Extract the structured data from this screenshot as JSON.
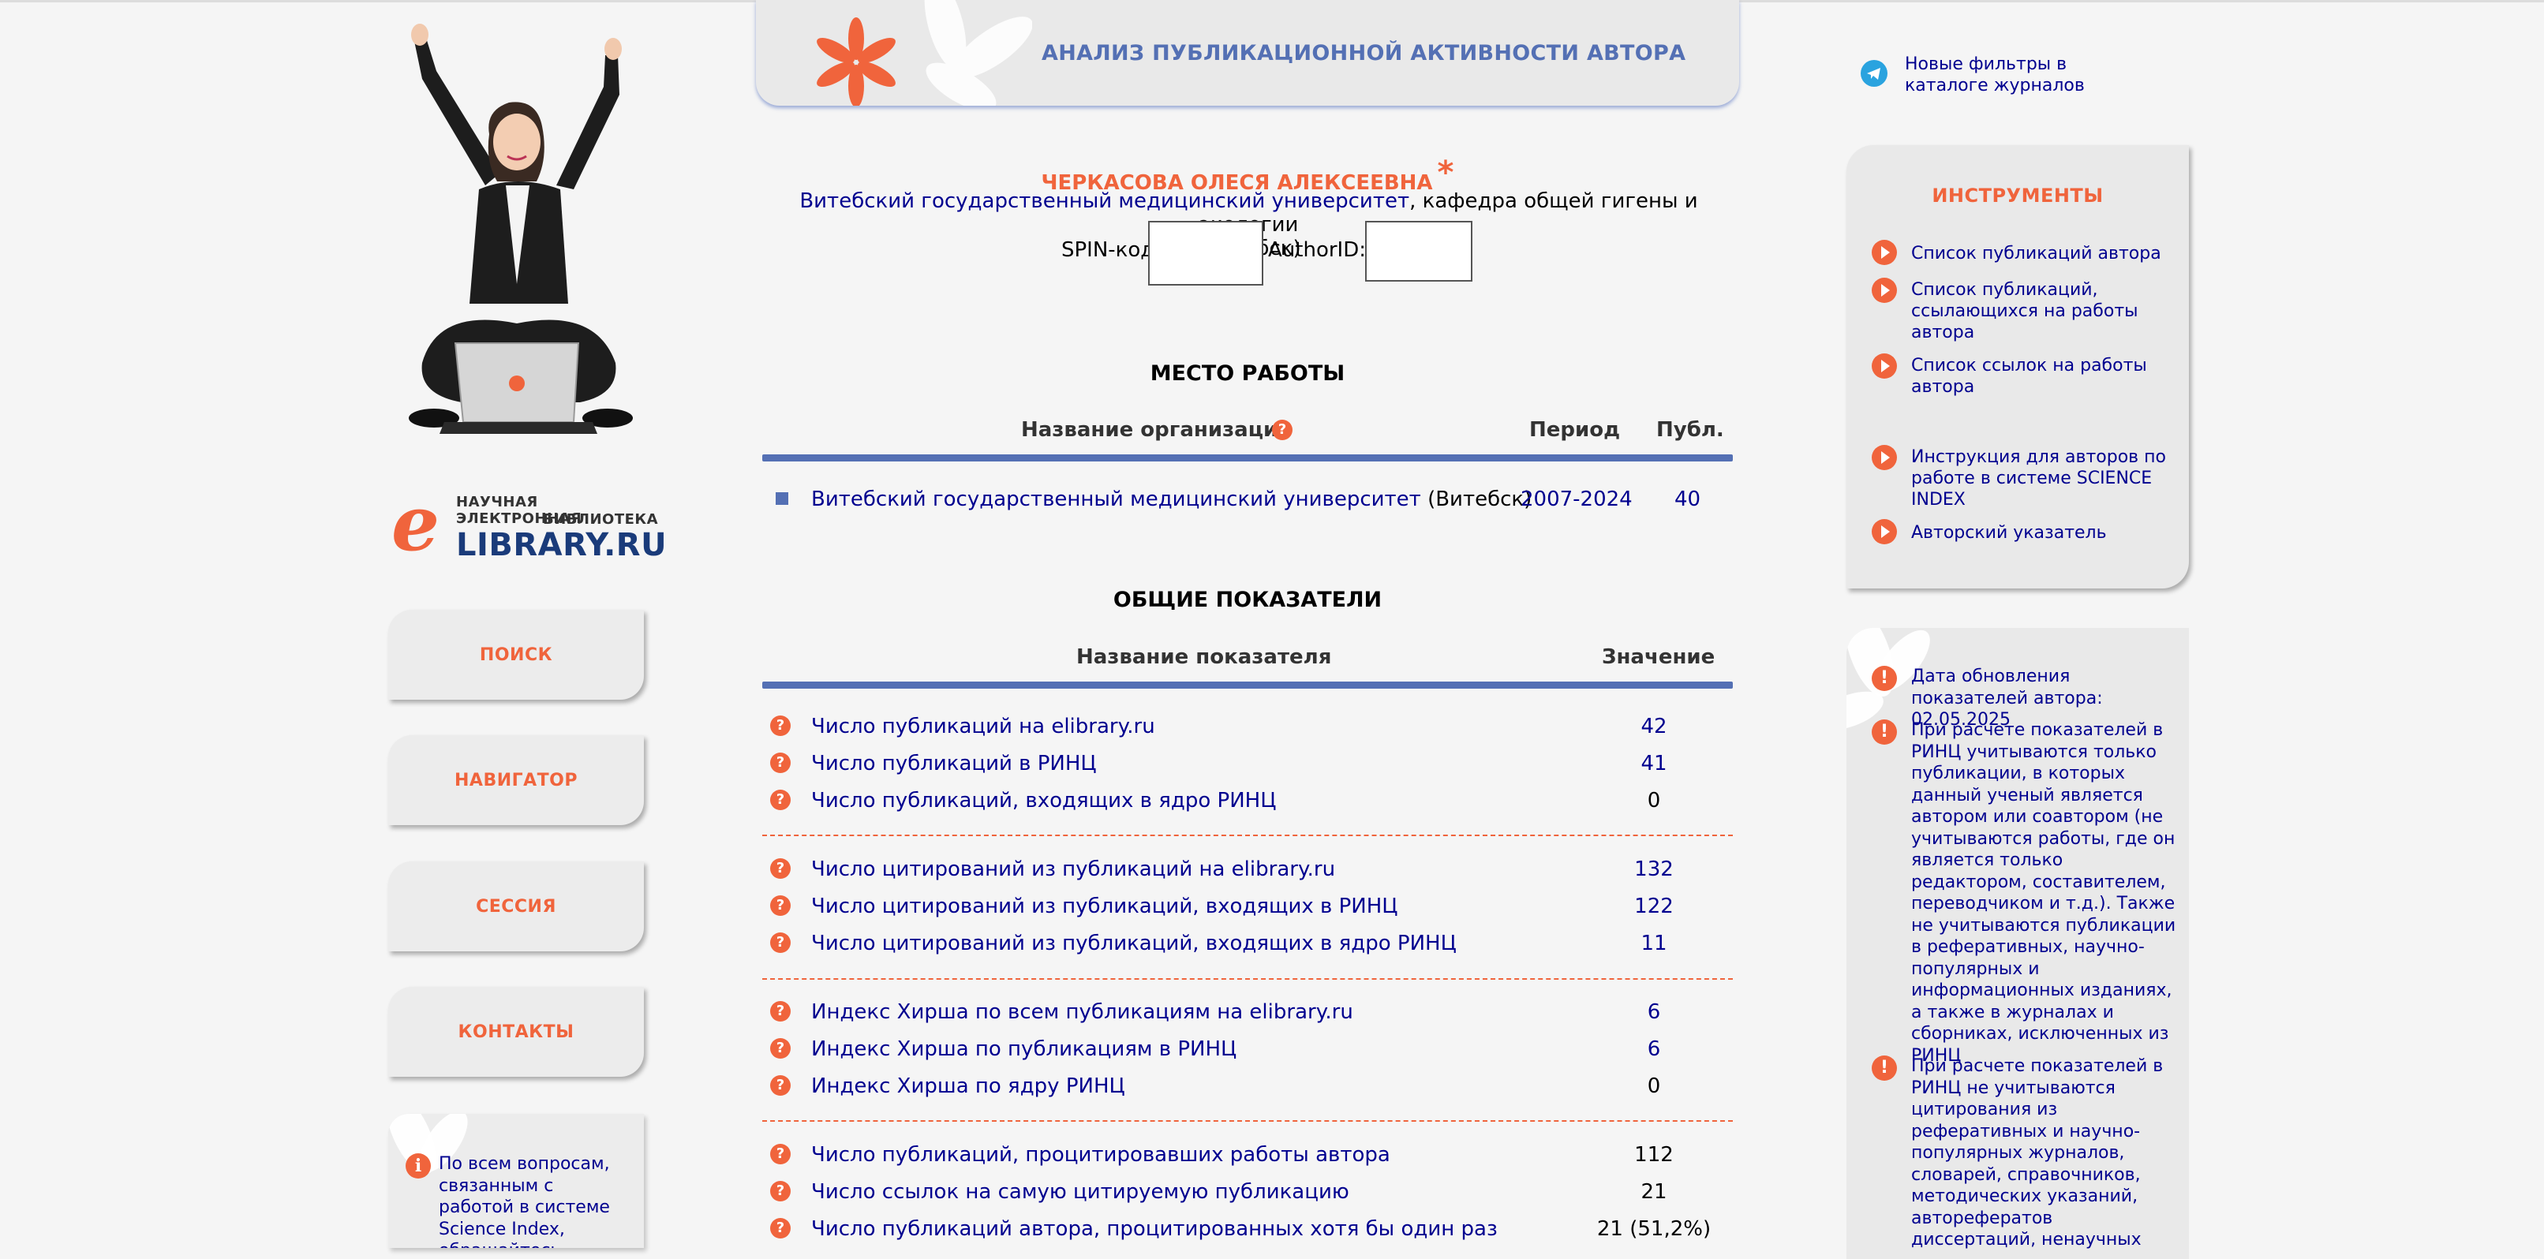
{
  "banner": {
    "title": "АНАЛИЗ ПУБЛИКАЦИОННОЙ АКТИВНОСТИ АВТОРА"
  },
  "author": {
    "name": "ЧЕРКАСОВА ОЛЕСЯ АЛЕКСЕЕВНА",
    "star": "*",
    "affiliation_link": "Витебский государственный медицинский университет",
    "affiliation_rest": ", кафедра общей гигены и экологии",
    "city": "(Витебск)",
    "spin_label": "SPIN-код:",
    "authorid_label": "AuthorID:"
  },
  "logo": {
    "line1": "НАУЧНАЯ ЭЛЕКТРОННАЯ",
    "line2": "БИБЛИОТЕКА",
    "line3": "LIBRARY.RU",
    "e_letter": "e"
  },
  "nav": {
    "search": "ПОИСК",
    "navigator": "НАВИГАТОР",
    "session": "СЕССИЯ",
    "contacts": "КОНТАКТЫ"
  },
  "help": {
    "text": "По всем вопросам, связанным с работой в системе Science Index, обращайтесь"
  },
  "workplace": {
    "title": "МЕСТО РАБОТЫ",
    "col_org": "Название организации",
    "col_period": "Период",
    "col_pub": "Публ.",
    "rows": [
      {
        "org": "Витебский государственный медицинский университет",
        "city": "(Витебск)",
        "period": "2007-2024",
        "pub": "40"
      }
    ]
  },
  "indicators": {
    "title": "ОБЩИЕ ПОКАЗАТЕЛИ",
    "col_name": "Название показателя",
    "col_value": "Значение",
    "rows": [
      {
        "label": "Число публикаций на elibrary.ru",
        "value": "42"
      },
      {
        "label": "Число публикаций в РИНЦ",
        "value": "41"
      },
      {
        "label": "Число публикаций, входящих в ядро РИНЦ",
        "value": "0"
      },
      {
        "label": "Число цитирований из публикаций на elibrary.ru",
        "value": "132"
      },
      {
        "label": "Число цитирований из публикаций, входящих в РИНЦ",
        "value": "122"
      },
      {
        "label": "Число цитирований из публикаций, входящих в ядро РИНЦ",
        "value": "11"
      },
      {
        "label": "Индекс Хирша по всем публикациям на elibrary.ru",
        "value": "6"
      },
      {
        "label": "Индекс Хирша по публикациям в РИНЦ",
        "value": "6"
      },
      {
        "label": "Индекс Хирша по ядру РИНЦ",
        "value": "0"
      },
      {
        "label": "Число публикаций, процитировавших работы автора",
        "value": "112"
      },
      {
        "label": "Число ссылок на самую цитируемую публикацию",
        "value": "21"
      },
      {
        "label": "Число публикаций автора, процитированных хотя бы один раз",
        "value": "21 (51,2%)"
      }
    ]
  },
  "telegram": {
    "text": "Новые фильтры в каталоге журналов"
  },
  "tools": {
    "title": "ИНСТРУМЕНТЫ",
    "items": [
      "Список публикаций автора",
      "Список публикаций, ссылающихся на работы автора",
      "Список ссылок на работы автора",
      "Инструкция для авторов по работе в системе SCIENCE INDEX",
      "Авторский указатель"
    ]
  },
  "info": {
    "items": [
      "Дата обновления показателей автора: 02.05.2025",
      "При расчете показателей в РИНЦ учитываются только публикации, в которых данный ученый является автором или соавтором (не учитываются работы, где он является только редактором, составителем, переводчиком и т.д.). Также не учитываются публикации в реферативных, научно-популярных и информационных изданиях, а также в журналах и сборниках, исключенных из РИНЦ",
      "При расчете показателей в РИНЦ не учитываются цитирования из реферативных и научно-популярных журналов, словарей, справочников, методических указаний, авторефератов диссертаций, ненаучных"
    ]
  },
  "colors": {
    "accent": "#f0643c",
    "blue": "#5470b4",
    "link": "#00008f"
  },
  "icons": {
    "question": "?",
    "exclamation": "!",
    "info": "i"
  }
}
